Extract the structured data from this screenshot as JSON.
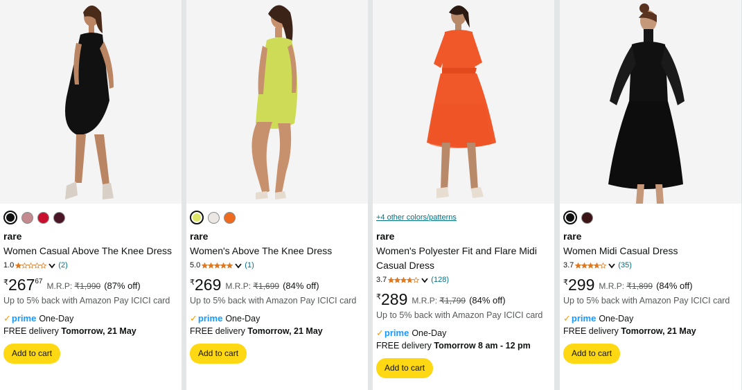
{
  "products": [
    {
      "colors": [
        "#111111",
        "#c48a8f",
        "#c8102e",
        "#4a1525"
      ],
      "selected_color": 0,
      "more_colors": "",
      "brand": "rare",
      "title_line1": "Women Casual Above The Knee Dress",
      "title_line2": "",
      "rating": "1.0",
      "rating_value": 1.0,
      "count": "(2)",
      "currency": "₹",
      "price_whole": "267",
      "price_fraction": "67",
      "mrp_label": "M.R.P:",
      "mrp": "₹1,990",
      "discount": "(87% off)",
      "cashback": "Up to 5% back with Amazon Pay ICICI card",
      "prime_label": "prime",
      "prime_speed": "One-Day",
      "delivery_prefix": "FREE delivery",
      "delivery_date": "Tomorrow, 21 May",
      "cart_label": "Add to cart"
    },
    {
      "colors": [
        "#dde667",
        "#ece7e3",
        "#ef6a1c"
      ],
      "selected_color": 0,
      "more_colors": "",
      "brand": "rare",
      "title_line1": "Women's Above The Knee Dress",
      "title_line2": "",
      "rating": "5.0",
      "rating_value": 5.0,
      "count": "(1)",
      "currency": "₹",
      "price_whole": "269",
      "price_fraction": "",
      "mrp_label": "M.R.P:",
      "mrp": "₹1,699",
      "discount": "(84% off)",
      "cashback": "Up to 5% back with Amazon Pay ICICI card",
      "prime_label": "prime",
      "prime_speed": "One-Day",
      "delivery_prefix": "FREE delivery",
      "delivery_date": "Tomorrow, 21 May",
      "cart_label": "Add to cart"
    },
    {
      "colors": [],
      "selected_color": -1,
      "more_colors": "+4 other colors/patterns",
      "brand": "rare",
      "title_line1": "Women's Polyester Fit and Flare Midi",
      "title_line2": "Casual Dress",
      "rating": "3.7",
      "rating_value": 3.7,
      "count": "(128)",
      "currency": "₹",
      "price_whole": "289",
      "price_fraction": "",
      "mrp_label": "M.R.P:",
      "mrp": "₹1,799",
      "discount": "(84% off)",
      "cashback": "Up to 5% back with Amazon Pay ICICI card",
      "prime_label": "prime",
      "prime_speed": "One-Day",
      "delivery_prefix": "FREE delivery",
      "delivery_date": "Tomorrow 8 am - 12 pm",
      "cart_label": "Add to cart"
    },
    {
      "colors": [
        "#111111",
        "#3b1416"
      ],
      "selected_color": 0,
      "more_colors": "",
      "brand": "rare",
      "title_line1": "Women Midi Casual Dress",
      "title_line2": "",
      "rating": "3.7",
      "rating_value": 3.7,
      "count": "(35)",
      "currency": "₹",
      "price_whole": "299",
      "price_fraction": "",
      "mrp_label": "M.R.P:",
      "mrp": "₹1,899",
      "discount": "(84% off)",
      "cashback": "Up to 5% back with Amazon Pay ICICI card",
      "prime_label": "prime",
      "prime_speed": "One-Day",
      "delivery_prefix": "FREE delivery",
      "delivery_date": "Tomorrow, 21 May",
      "cart_label": "Add to cart"
    }
  ],
  "theme": {
    "star_fill": "#de7921",
    "link": "#007185",
    "prime": "#1399ff",
    "button": "#ffd814"
  }
}
